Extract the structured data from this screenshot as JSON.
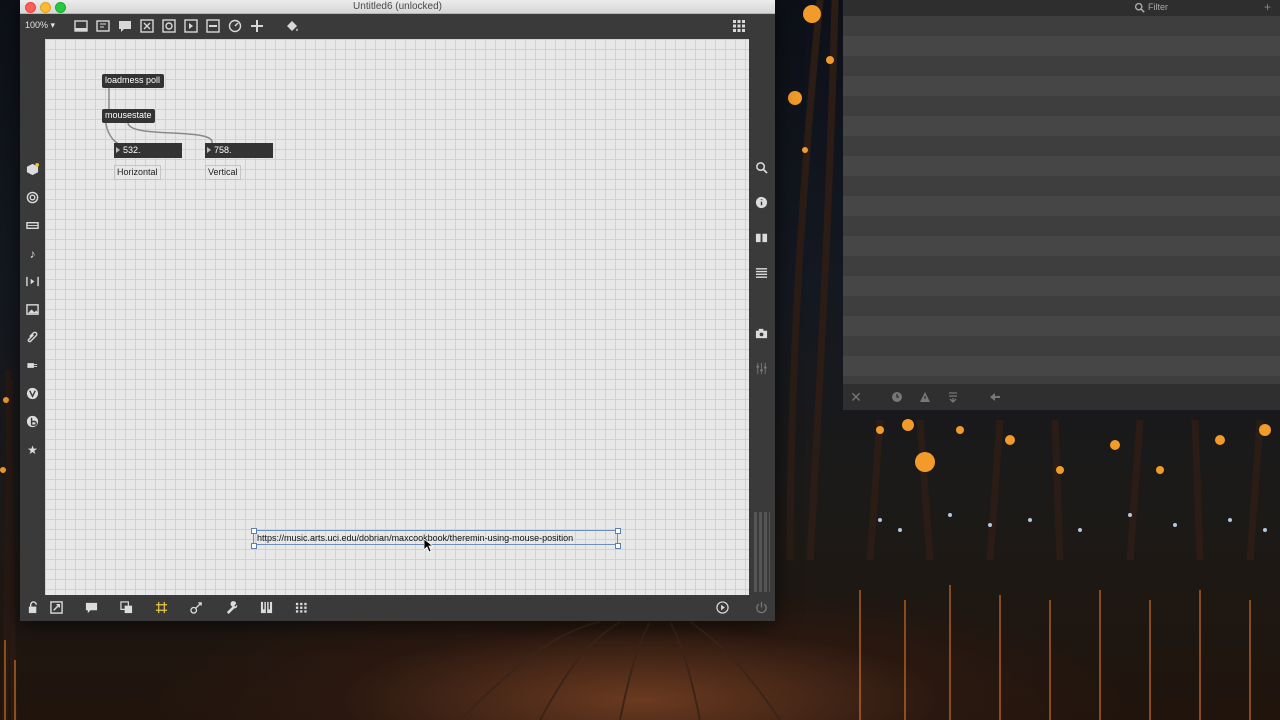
{
  "window": {
    "title": "Untitled6 (unlocked)"
  },
  "toolbar": {
    "zoom": "100%",
    "zoom_caret": "▾"
  },
  "patch": {
    "loadmess": "loadmess poll",
    "mousestate": "mousestate",
    "number_h": "532.",
    "number_v": "758.",
    "comment_h": "Horizontal",
    "comment_v": "Vertical",
    "url": "https://music.arts.uci.edu/dobrian/maxcookbook/theremin-using-mouse-position"
  },
  "console": {
    "filter_placeholder": "Filter",
    "add_symbol": "+"
  },
  "colors": {
    "canvas_bg": "#e8e8e8",
    "object_bg": "#333333",
    "selection": "#6d8fbf"
  }
}
